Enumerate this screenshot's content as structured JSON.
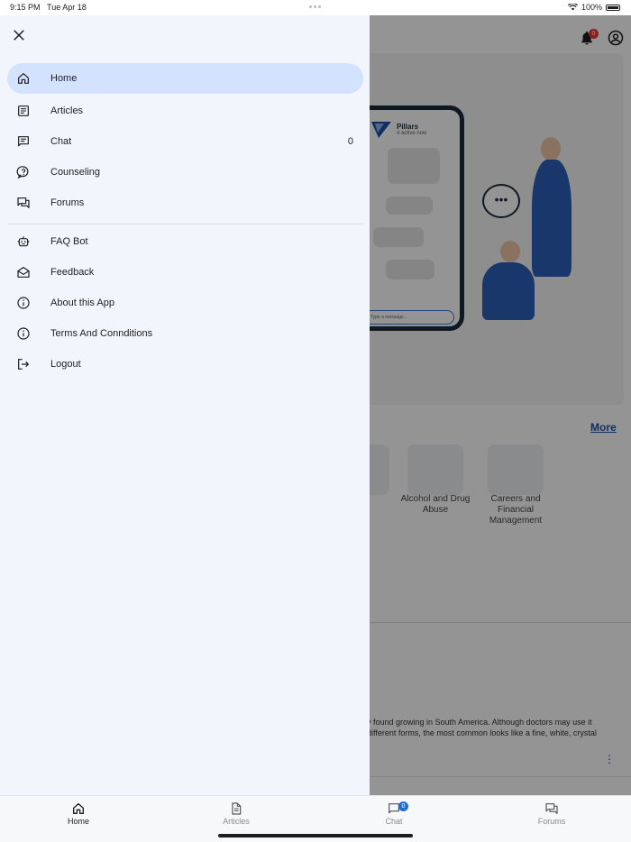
{
  "status_bar": {
    "time": "9:15 PM",
    "date": "Tue Apr 18",
    "battery": "100%"
  },
  "header": {
    "notification_count": "0"
  },
  "hero": {
    "chat_title": "Pillars",
    "chat_status": "4 active now",
    "input_placeholder": "Type a message...",
    "thought_dots": "•••"
  },
  "categories": {
    "more_label": "More",
    "items": [
      {
        "label": "Alcohol and Drug Abuse"
      },
      {
        "label": "Careers and Financial Management"
      }
    ]
  },
  "article": {
    "line1": "y found growing in South America. Although doctors may use it",
    "line2": "different forms, the most common looks like a fine, white, crystal",
    "kebab": "⋮"
  },
  "drawer": {
    "items": [
      {
        "label": "Home",
        "icon": "home-icon"
      },
      {
        "label": "Articles",
        "icon": "article-icon"
      },
      {
        "label": "Chat",
        "icon": "chat-icon",
        "count": "0"
      },
      {
        "label": "Counseling",
        "icon": "help-icon"
      },
      {
        "label": "Forums",
        "icon": "forum-icon"
      },
      {
        "label": "FAQ Bot",
        "icon": "robot-icon"
      },
      {
        "label": "Feedback",
        "icon": "mail-icon"
      },
      {
        "label": "About this App",
        "icon": "info-icon"
      },
      {
        "label": "Terms And Connditions",
        "icon": "info-icon"
      },
      {
        "label": "Logout",
        "icon": "logout-icon"
      }
    ]
  },
  "bottom_nav": {
    "tabs": [
      {
        "label": "Home"
      },
      {
        "label": "Articles"
      },
      {
        "label": "Chat",
        "badge": "0"
      },
      {
        "label": "Forums"
      }
    ]
  }
}
